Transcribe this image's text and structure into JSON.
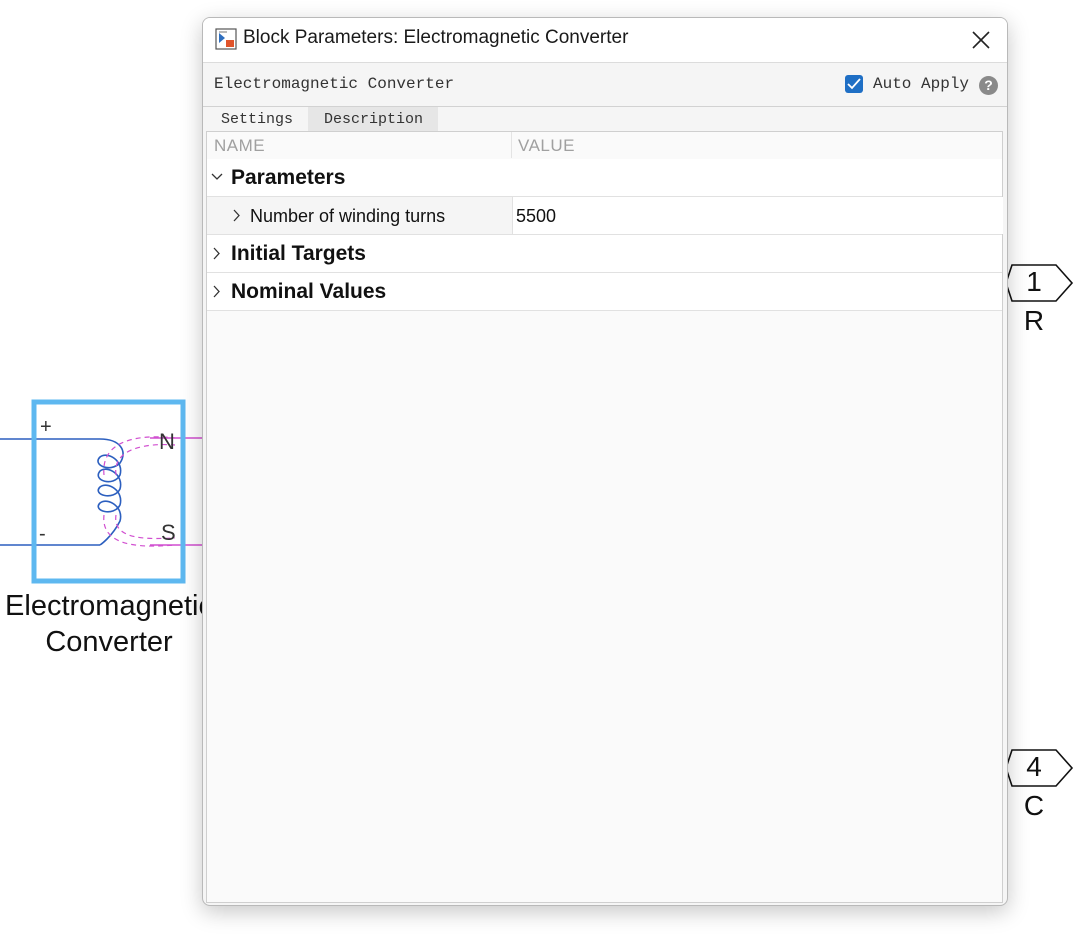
{
  "canvas": {
    "block": {
      "name": "Electromagnetic\nConverter",
      "port_plus": "+",
      "port_minus": "-",
      "port_n": "N",
      "port_s": "S"
    },
    "ports": [
      {
        "number": "1",
        "label": "R"
      },
      {
        "number": "4",
        "label": "C"
      }
    ]
  },
  "dialog": {
    "title": "Block Parameters: Electromagnetic Converter",
    "block_type": "Electromagnetic Converter",
    "auto_apply_label": "Auto Apply",
    "auto_apply_checked": true,
    "help_icon": "question-icon",
    "tabs": [
      {
        "label": "Settings",
        "active": true
      },
      {
        "label": "Description",
        "active": false
      }
    ],
    "table": {
      "col_name": "NAME",
      "col_value": "VALUE",
      "groups": [
        {
          "label": "Parameters",
          "expanded": true,
          "params": [
            {
              "label": "Number of winding turns",
              "value": "5500"
            }
          ]
        },
        {
          "label": "Initial Targets",
          "expanded": false
        },
        {
          "label": "Nominal Values",
          "expanded": false
        }
      ]
    }
  },
  "colors": {
    "block_border": "#5eb8f0",
    "wire_blue": "#2c5fbf",
    "wire_magenta": "#d14fd0",
    "checkbox": "#1f6fc5"
  }
}
